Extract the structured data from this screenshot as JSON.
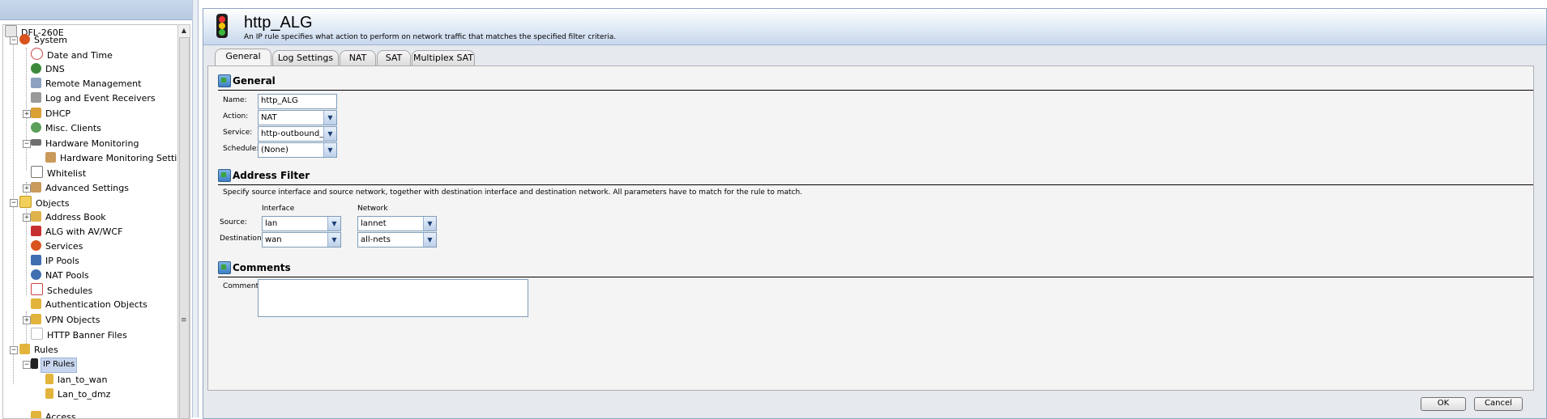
{
  "tree": {
    "root": "DFL-260E",
    "items": [
      {
        "label": "System"
      },
      {
        "label": "Date and Time"
      },
      {
        "label": "DNS"
      },
      {
        "label": "Remote Management"
      },
      {
        "label": "Log and Event Receivers"
      },
      {
        "label": "DHCP"
      },
      {
        "label": "Misc. Clients"
      },
      {
        "label": "Hardware Monitoring"
      },
      {
        "label": "Hardware Monitoring Setting"
      },
      {
        "label": "Whitelist"
      },
      {
        "label": "Advanced Settings"
      },
      {
        "label": "Objects"
      },
      {
        "label": "Address Book"
      },
      {
        "label": "ALG with AV/WCF"
      },
      {
        "label": "Services"
      },
      {
        "label": "IP Pools"
      },
      {
        "label": "NAT Pools"
      },
      {
        "label": "Schedules"
      },
      {
        "label": "Authentication Objects"
      },
      {
        "label": "VPN Objects"
      },
      {
        "label": "HTTP Banner Files"
      },
      {
        "label": "Rules"
      },
      {
        "label": "IP Rules"
      },
      {
        "label": "lan_to_wan"
      },
      {
        "label": "Lan_to_dmz"
      },
      {
        "label": "Access"
      }
    ]
  },
  "header": {
    "title": "http_ALG",
    "description": "An IP rule specifies what action to perform on network traffic that matches the specified filter criteria."
  },
  "tabs": [
    {
      "label": "General"
    },
    {
      "label": "Log Settings"
    },
    {
      "label": "NAT"
    },
    {
      "label": "SAT"
    },
    {
      "label": "Multiplex SAT"
    }
  ],
  "general": {
    "title": "General",
    "name_label": "Name:",
    "name_value": "http_ALG",
    "action_label": "Action:",
    "action_value": "NAT",
    "service_label": "Service:",
    "service_value": "http-outbound_with_",
    "schedule_label": "Schedule:",
    "schedule_value": "(None)"
  },
  "address_filter": {
    "title": "Address Filter",
    "description": "Specify source interface and source network, together with destination interface and destination network. All parameters have to match for the rule to match.",
    "col_interface": "Interface",
    "col_network": "Network",
    "source_label": "Source:",
    "source_interface": "lan",
    "source_network": "lannet",
    "destination_label": "Destination:",
    "destination_interface": "wan",
    "destination_network": "all-nets"
  },
  "comments": {
    "title": "Comments",
    "label": "Comments:",
    "value": ""
  },
  "buttons": {
    "ok": "OK",
    "cancel": "Cancel"
  }
}
